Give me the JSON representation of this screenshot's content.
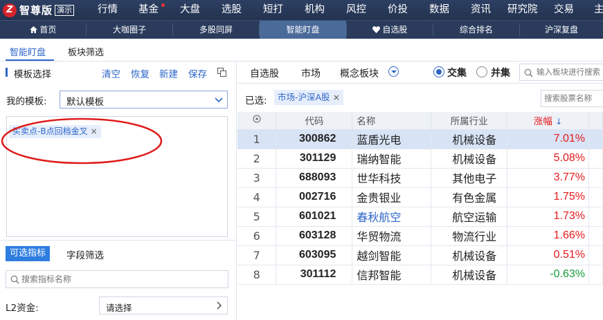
{
  "app": {
    "logo_char": "Z",
    "name": "智尊版",
    "demo_badge": "演示"
  },
  "top_menu": [
    "行情",
    "基金",
    "大盘",
    "选股",
    "短打",
    "机构",
    "风控",
    "价投",
    "数据",
    "资讯",
    "研究院",
    "交易",
    "主"
  ],
  "sub_nav": [
    "首页",
    "大咖圈子",
    "多股同屏",
    "智能盯盘",
    "自选股",
    "综合排名",
    "沪深复盘"
  ],
  "tabs": [
    "智能盯盘",
    "板块筛选"
  ],
  "left": {
    "title": "模板选择",
    "actions": [
      "清空",
      "恢复",
      "新建",
      "保存"
    ],
    "template_label": "我的模板:",
    "template_value": "默认模板",
    "chip": "买卖点-B点回档金叉",
    "section_tabs": [
      "可选指标",
      "字段筛选"
    ],
    "indicator_search_placeholder": "搜索指标名称",
    "l2_label": "L2资金:",
    "l2_value": "请选择"
  },
  "right": {
    "tabs": [
      "自选股",
      "市场",
      "概念板块"
    ],
    "radio": [
      {
        "label": "交集",
        "checked": true
      },
      {
        "label": "并集",
        "checked": false
      }
    ],
    "block_search_placeholder": "输入板块进行搜索",
    "selected_label": "已选:",
    "selected_chip": "市场-沪深A股",
    "stock_search_placeholder": "搜索股票名称",
    "columns": [
      "代码",
      "名称",
      "所属行业",
      "涨幅"
    ],
    "rows": [
      {
        "idx": "1",
        "code": "300862",
        "name": "蓝盾光电",
        "industry": "机械设备",
        "change": "7.01%"
      },
      {
        "idx": "2",
        "code": "301129",
        "name": "瑞纳智能",
        "industry": "机械设备",
        "change": "5.08%"
      },
      {
        "idx": "3",
        "code": "688093",
        "name": "世华科技",
        "industry": "其他电子",
        "change": "3.77%"
      },
      {
        "idx": "4",
        "code": "002716",
        "name": "金贵银业",
        "industry": "有色金属",
        "change": "1.75%"
      },
      {
        "idx": "5",
        "code": "601021",
        "name": "春秋航空",
        "industry": "航空运输",
        "change": "1.73%"
      },
      {
        "idx": "6",
        "code": "603128",
        "name": "华贸物流",
        "industry": "物流行业",
        "change": "1.66%"
      },
      {
        "idx": "7",
        "code": "603095",
        "name": "越剑智能",
        "industry": "机械设备",
        "change": "0.51%"
      },
      {
        "idx": "8",
        "code": "301112",
        "name": "信邦智能",
        "industry": "机械设备",
        "change": "-0.63%"
      }
    ]
  },
  "colors": {
    "accent": "#2e66c8",
    "up": "#e5191c",
    "down": "#179c3a",
    "header_bg": "#23334f",
    "annotation": "#e01b1b"
  }
}
